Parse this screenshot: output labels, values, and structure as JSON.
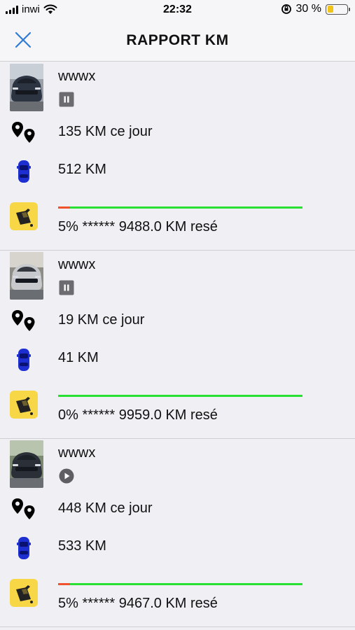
{
  "status_bar": {
    "carrier": "inwi",
    "time": "22:32",
    "battery": "30 %",
    "battery_level": 0.3
  },
  "header": {
    "title": "RAPPORT KM",
    "close_icon": "close-icon"
  },
  "colors": {
    "accent": "#2f7bd6",
    "fuel_remaining": "#28e032",
    "fuel_used": "#f0522e",
    "fuel_badge": "#f7d746",
    "car_blue": "#1d2fd1"
  },
  "vehicles": [
    {
      "name": "wwwx",
      "state_icon": "pause-icon",
      "today_km": "135 KM ce jour",
      "total_km": "512 KM",
      "fuel_text": "5% ****** 9488.0 KM resé",
      "fuel_used_fraction": 0.05
    },
    {
      "name": "wwwx",
      "state_icon": "pause-icon",
      "today_km": "19 KM ce jour",
      "total_km": "41 KM",
      "fuel_text": "0% ****** 9959.0 KM resé",
      "fuel_used_fraction": 0.0
    },
    {
      "name": "wwwx",
      "state_icon": "play-icon",
      "today_km": "448 KM ce jour",
      "total_km": "533 KM",
      "fuel_text": "5% ****** 9467.0 KM resé",
      "fuel_used_fraction": 0.05
    }
  ]
}
